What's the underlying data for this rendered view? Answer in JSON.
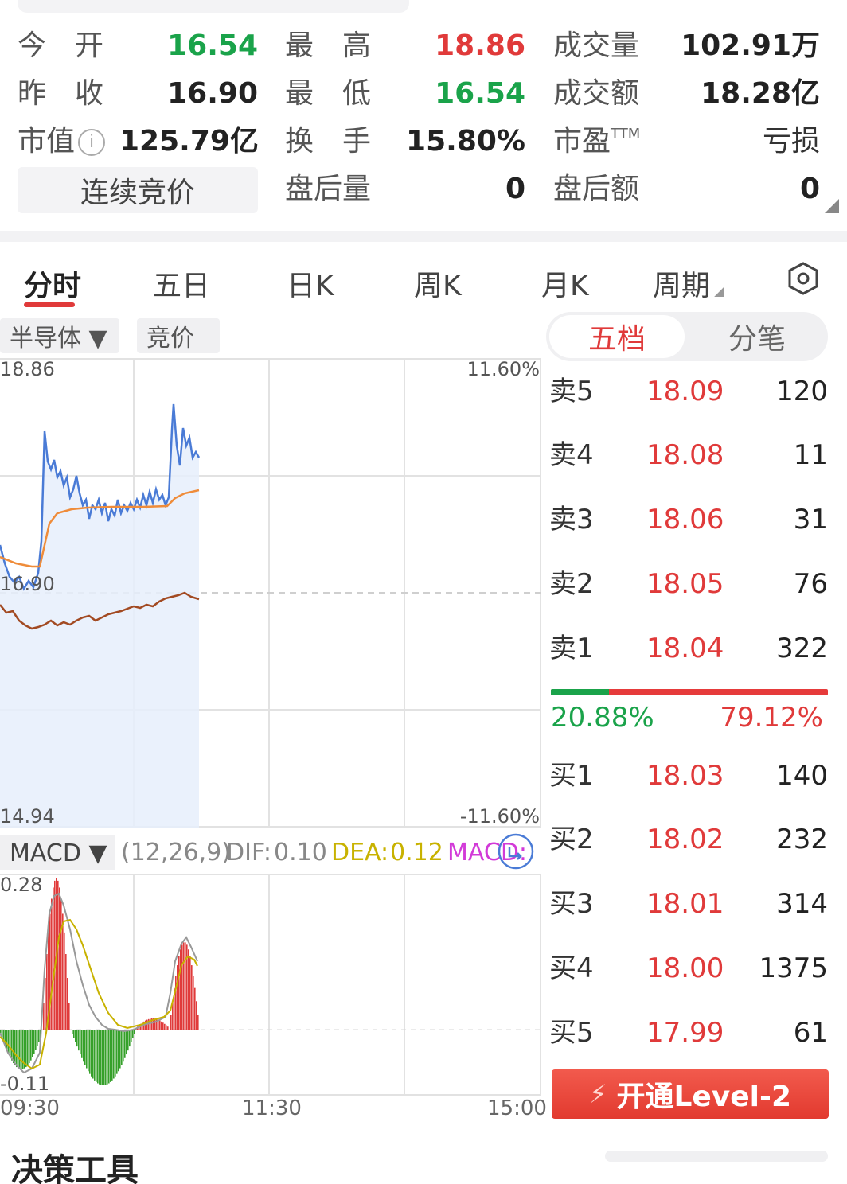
{
  "quote": {
    "rows": [
      {
        "l1": "今　开",
        "v1": "16.54",
        "l2": "最　高",
        "v2": "18.86",
        "l3": "成交量",
        "v3": "102.91万"
      },
      {
        "l1": "昨　收",
        "v1": "16.90",
        "l2": "最　低",
        "v2": "16.54",
        "l3": "成交额",
        "v3": "18.28亿"
      },
      {
        "l1": "市值",
        "v1": "125.79亿",
        "l2": "换　手",
        "v2": "15.80%",
        "l3": "市盈",
        "l3_sup": "TTM",
        "v3": "亏损"
      },
      {
        "l1": "",
        "v1": "",
        "l2": "盘后量",
        "v2": "0",
        "l3": "盘后额",
        "v3": "0"
      }
    ],
    "continuous_bid": "连续竞价",
    "info_icon": "info-icon",
    "colors": {
      "up": "#e03a3a",
      "down": "#1aa34a"
    }
  },
  "tabs": [
    "分时",
    "五日",
    "日K",
    "周K",
    "月K",
    "周期"
  ],
  "active_tab": "分时",
  "settings_icon": "hexagon-gear-icon",
  "chips": {
    "sector": "半导体 ▼",
    "auction": "竞价"
  },
  "price_chart": {
    "y_top": "18.86",
    "y_mid": "16.90",
    "y_bottom": "14.94",
    "pct_top": "11.60%",
    "pct_bottom": "-11.60%"
  },
  "macd": {
    "name": "MACD ▼",
    "params": "(12,26,9)",
    "dif_label": "DIF:",
    "dif": "0.10",
    "dea_label": "DEA:",
    "dea": "0.12",
    "macd_label": "MACD:",
    "y_top": "0.28",
    "y_bottom": "-0.11",
    "x_labels": [
      "09:30",
      "11:30",
      "15:00"
    ]
  },
  "order_book": {
    "seg_active": "五档",
    "seg_inactive": "分笔",
    "asks": [
      {
        "label": "卖5",
        "price": "18.09",
        "vol": "120"
      },
      {
        "label": "卖4",
        "price": "18.08",
        "vol": "11"
      },
      {
        "label": "卖3",
        "price": "18.06",
        "vol": "31"
      },
      {
        "label": "卖2",
        "price": "18.05",
        "vol": "76"
      },
      {
        "label": "卖1",
        "price": "18.04",
        "vol": "322"
      }
    ],
    "ratio_sell": "20.88%",
    "ratio_buy": "79.12%",
    "ratio_sell_fraction": 0.2088,
    "bids": [
      {
        "label": "买1",
        "price": "18.03",
        "vol": "140"
      },
      {
        "label": "买2",
        "price": "18.02",
        "vol": "232"
      },
      {
        "label": "买3",
        "price": "18.01",
        "vol": "314"
      },
      {
        "label": "买4",
        "price": "18.00",
        "vol": "1375"
      },
      {
        "label": "买5",
        "price": "17.99",
        "vol": "61"
      }
    ],
    "level2_button": "开通Level-2"
  },
  "footer": {
    "title": "决策工具"
  }
}
